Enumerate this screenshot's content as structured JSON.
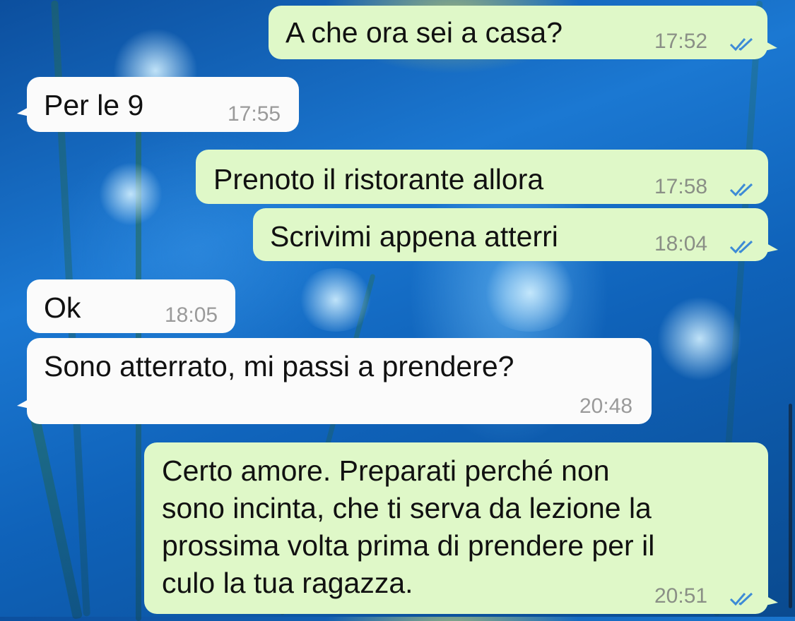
{
  "messages": [
    {
      "direction": "out",
      "text": "A che ora sei a casa?",
      "time": "17:52",
      "status": "read"
    },
    {
      "direction": "in",
      "text": "Per le 9",
      "time": "17:55"
    },
    {
      "direction": "out",
      "text": "Prenoto il ristorante allora",
      "time": "17:58",
      "status": "read"
    },
    {
      "direction": "out",
      "text": "Scrivimi appena atterri",
      "time": "18:04",
      "status": "read"
    },
    {
      "direction": "in",
      "text": "Ok",
      "time": "18:05"
    },
    {
      "direction": "in",
      "text": "Sono atterrato, mi passi a prendere?",
      "time": "20:48"
    },
    {
      "direction": "out",
      "text_lines": [
        "Certo amore. Preparati perché non",
        "sono incinta, che ti serva da lezione la",
        "prossima volta prima di prendere per il",
        "culo la tua ragazza."
      ],
      "time": "20:51",
      "status": "read"
    }
  ],
  "colors": {
    "outgoing_bubble": "#dff8c8",
    "incoming_bubble": "#fbfbfb",
    "read_checks": "#3d8bd6",
    "timestamp": "#8a8f86"
  },
  "icons": {
    "read_receipt": "double-check-icon"
  }
}
